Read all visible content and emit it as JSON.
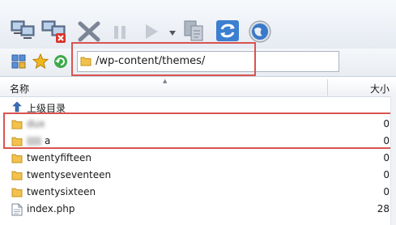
{
  "address": {
    "path": "/wp-content/themes/"
  },
  "header": {
    "name_col": "名称",
    "size_col": "大小"
  },
  "parent_dir": {
    "label": "上级目录"
  },
  "files": [
    {
      "name": "dux",
      "size": "0",
      "type": "folder",
      "redacted": true
    },
    {
      "name": "a",
      "size": "0",
      "type": "folder",
      "redacted": true
    },
    {
      "name": "twentyfifteen",
      "size": "0",
      "type": "folder"
    },
    {
      "name": "twentyseventeen",
      "size": "0",
      "type": "folder"
    },
    {
      "name": "twentysixteen",
      "size": "0",
      "type": "folder"
    },
    {
      "name": "index.php",
      "size": "28",
      "type": "file"
    }
  ],
  "colors": {
    "highlight": "#d9534f",
    "folder": "#f2c14e"
  },
  "icons": [
    "connect-icon",
    "disconnect-icon",
    "cancel-icon",
    "pause-icon",
    "play-icon",
    "dropdown-arrow-icon",
    "copy-icon",
    "refresh-icon",
    "globe-icon",
    "layout-icon",
    "star-icon",
    "go-icon",
    "folder-icon",
    "up-arrow-icon",
    "file-icon"
  ]
}
